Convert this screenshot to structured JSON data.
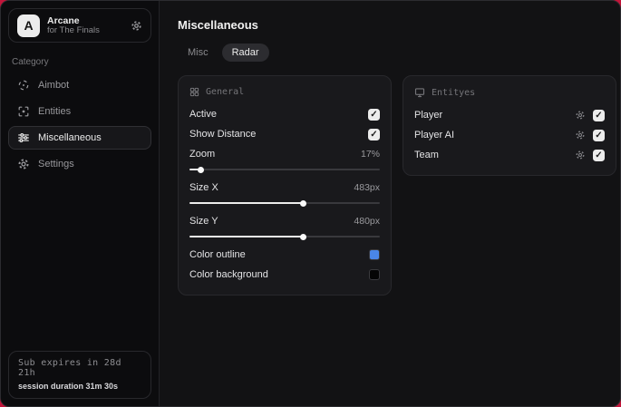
{
  "window": {
    "desktop_color": "#c2153a"
  },
  "sidebar": {
    "brand": {
      "avatar_letter": "A",
      "title": "Arcane",
      "subtitle": "for The Finals"
    },
    "category_label": "Category",
    "items": [
      {
        "label": "Aimbot",
        "icon": "crosshair-icon",
        "active": false
      },
      {
        "label": "Entities",
        "icon": "entities-icon",
        "active": false
      },
      {
        "label": "Miscellaneous",
        "icon": "sliders-icon",
        "active": true
      },
      {
        "label": "Settings",
        "icon": "gear-icon",
        "active": false
      }
    ],
    "footer": {
      "sub_expires": "Sub expires in 28d 21h",
      "session_duration": "session duration 31m 30s"
    }
  },
  "main": {
    "title": "Miscellaneous",
    "tabs": [
      {
        "label": "Misc",
        "active": false
      },
      {
        "label": "Radar",
        "active": true
      }
    ],
    "general": {
      "title": "General",
      "rows": {
        "active": {
          "label": "Active",
          "checked": true
        },
        "show_distance": {
          "label": "Show Distance",
          "checked": true
        },
        "zoom": {
          "label": "Zoom",
          "value": "17%",
          "percent": 6
        },
        "size_x": {
          "label": "Size X",
          "value": "483px",
          "percent": 60
        },
        "size_y": {
          "label": "Size Y",
          "value": "480px",
          "percent": 60
        },
        "color_outline": {
          "label": "Color outline",
          "color": "#4a86e8"
        },
        "color_background": {
          "label": "Color background",
          "color": "#050505"
        }
      }
    },
    "entities": {
      "title": "Entityes",
      "rows": [
        {
          "label": "Player",
          "checked": true
        },
        {
          "label": "Player AI",
          "checked": true
        },
        {
          "label": "Team",
          "checked": true
        }
      ]
    }
  },
  "icons": {
    "checkmark": "✓"
  }
}
